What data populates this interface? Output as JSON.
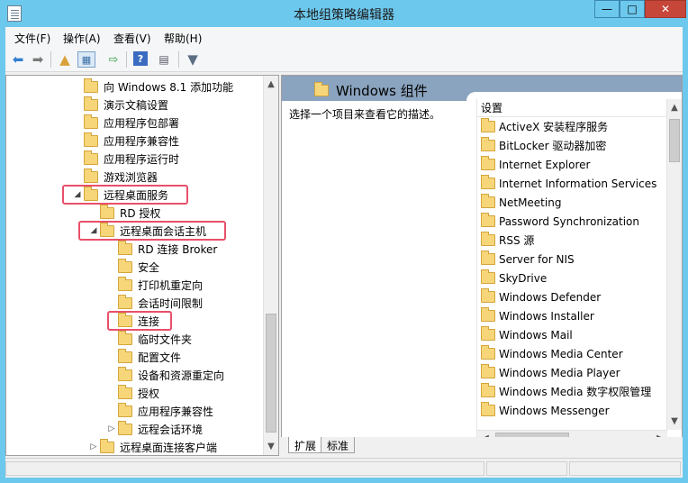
{
  "window": {
    "title": "本地组策略编辑器"
  },
  "menu": [
    "文件(F)",
    "操作(A)",
    "查看(V)",
    "帮助(H)"
  ],
  "tree": [
    {
      "label": "向 Windows 8.1 添加功能",
      "indent": 0,
      "expander": ""
    },
    {
      "label": "演示文稿设置",
      "indent": 0,
      "expander": ""
    },
    {
      "label": "应用程序包部署",
      "indent": 0,
      "expander": ""
    },
    {
      "label": "应用程序兼容性",
      "indent": 0,
      "expander": ""
    },
    {
      "label": "应用程序运行时",
      "indent": 0,
      "expander": ""
    },
    {
      "label": "游戏浏览器",
      "indent": 0,
      "expander": ""
    },
    {
      "label": "远程桌面服务",
      "indent": 0,
      "expander": "◢"
    },
    {
      "label": "RD 授权",
      "indent": 1,
      "expander": ""
    },
    {
      "label": "远程桌面会话主机",
      "indent": 1,
      "expander": "◢"
    },
    {
      "label": "RD 连接 Broker",
      "indent": 2,
      "expander": ""
    },
    {
      "label": "安全",
      "indent": 2,
      "expander": ""
    },
    {
      "label": "打印机重定向",
      "indent": 2,
      "expander": ""
    },
    {
      "label": "会话时间限制",
      "indent": 2,
      "expander": ""
    },
    {
      "label": "连接",
      "indent": 2,
      "expander": ""
    },
    {
      "label": "临时文件夹",
      "indent": 2,
      "expander": ""
    },
    {
      "label": "配置文件",
      "indent": 2,
      "expander": ""
    },
    {
      "label": "设备和资源重定向",
      "indent": 2,
      "expander": ""
    },
    {
      "label": "授权",
      "indent": 2,
      "expander": ""
    },
    {
      "label": "应用程序兼容性",
      "indent": 2,
      "expander": ""
    },
    {
      "label": "远程会话环境",
      "indent": 2,
      "expander": "▷"
    },
    {
      "label": "远程桌面连接客户端",
      "indent": 1,
      "expander": "▷"
    }
  ],
  "right_pane": {
    "title": "Windows 组件",
    "description": "选择一个项目来查看它的描述。",
    "list_header": "设置",
    "items": [
      "ActiveX 安装程序服务",
      "BitLocker 驱动器加密",
      "Internet Explorer",
      "Internet Information Services",
      "NetMeeting",
      "Password Synchronization",
      "RSS 源",
      "Server for NIS",
      "SkyDrive",
      "Windows Defender",
      "Windows Installer",
      "Windows Mail",
      "Windows Media Center",
      "Windows Media Player",
      "Windows Media 数字权限管理",
      "Windows Messenger"
    ]
  },
  "tabs": [
    "扩展",
    "标准"
  ],
  "colors": {
    "highlight": "#e8506a",
    "titlebar": "#6dc8ed",
    "header": "#8aa3be",
    "close": "#c7463a"
  }
}
